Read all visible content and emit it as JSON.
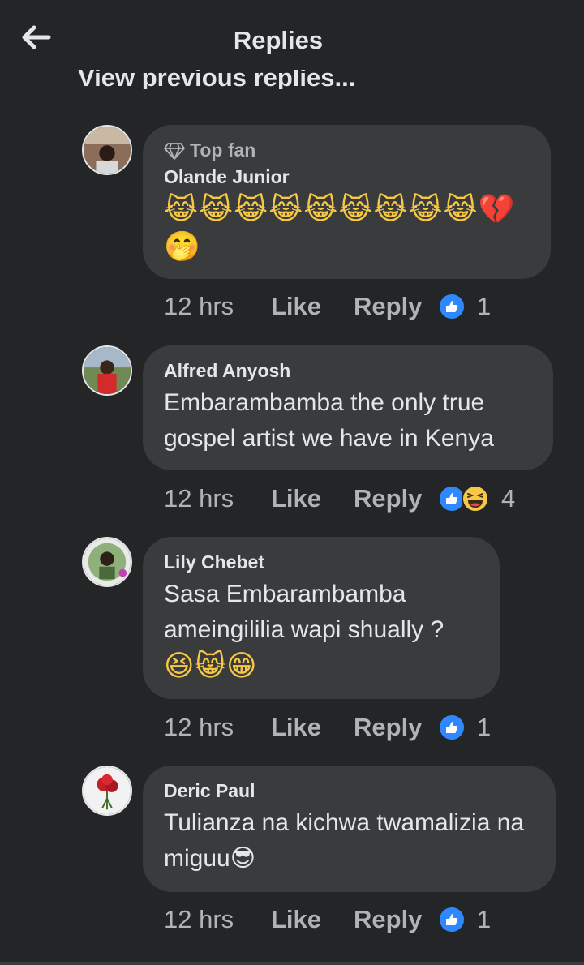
{
  "header": {
    "title": "Replies",
    "back_icon": "back-arrow-icon"
  },
  "previous_replies": {
    "label": "View previous replies..."
  },
  "comments": [
    {
      "badge": "Top fan",
      "author": "Olande Junior",
      "text": "",
      "emojis": "😹😹😹😹😹😹😹😹😹💔🤭",
      "time": "12 hrs",
      "like": "Like",
      "reply": "Reply",
      "reaction_count": "1",
      "reactions": [
        "like"
      ]
    },
    {
      "author": "Alfred Anyosh",
      "text": "Embarambamba the only true gospel artist we have in Kenya",
      "time": "12 hrs",
      "like": "Like",
      "reply": "Reply",
      "reaction_count": "4",
      "reactions": [
        "like",
        "haha"
      ]
    },
    {
      "author": "Lily Chebet",
      "text": "Sasa Embarambamba ameingililia wapi shually ?",
      "emojis": "😆😸😁",
      "time": "12 hrs",
      "like": "Like",
      "reply": "Reply",
      "reaction_count": "1",
      "reactions": [
        "like"
      ]
    },
    {
      "author": "Deric Paul",
      "text": "Tulianza na kichwa twamalizia na miguu😎",
      "time": "12 hrs",
      "like": "Like",
      "reply": "Reply",
      "reaction_count": "1",
      "reactions": [
        "like"
      ]
    }
  ],
  "colors": {
    "background": "#242526",
    "bubble": "#3a3b3c",
    "text": "#e4e6eb",
    "secondary_text": "#b0b3b8",
    "like_blue": "#2e89ff"
  }
}
